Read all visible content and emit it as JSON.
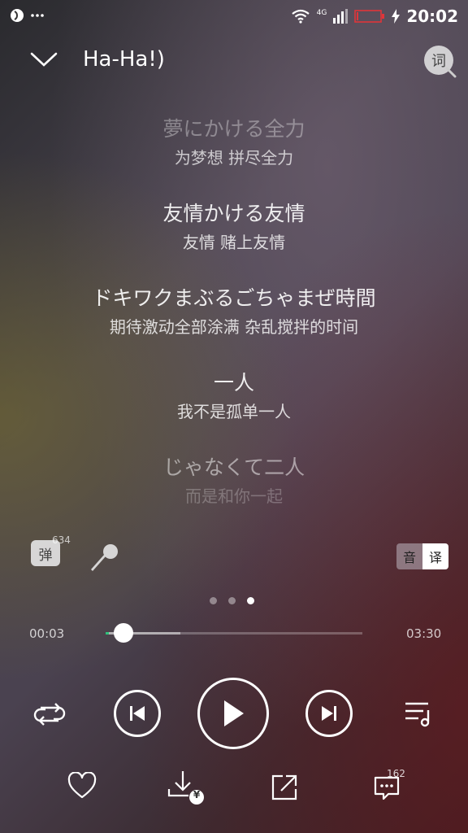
{
  "status_bar": {
    "network": "4G",
    "time": "20:02",
    "icons": [
      "app-icon",
      "more-dots-icon",
      "wifi-icon",
      "signal-icon",
      "battery-low-icon",
      "charging-icon"
    ]
  },
  "header": {
    "title": "Ha-Ha!)",
    "lyrics_button_label": "词"
  },
  "lyrics": [
    {
      "original": "夢にかける全力",
      "translation": "为梦想 拼尽全力"
    },
    {
      "original": "友情かける友情",
      "translation": "友情 赌上友情"
    },
    {
      "original": "ドキワクまぶるごちゃまぜ時間",
      "translation": "期待激动全部涂满 杂乱搅拌的时间"
    },
    {
      "original": "一人",
      "translation": "我不是孤单一人"
    },
    {
      "original": "じゃなくて二人",
      "translation": "而是和你一起"
    }
  ],
  "tools": {
    "danmu_label": "弹",
    "danmu_count": "634",
    "lang_toggle": {
      "left": "音",
      "right": "译"
    }
  },
  "pager": {
    "count": 3,
    "active_index": 2
  },
  "player": {
    "current_time": "00:03",
    "total_time": "03:30",
    "progress_fraction": 0.014,
    "buffered_fraction": 0.29
  },
  "bottom_bar": {
    "comment_count": "162",
    "download_badge": "¥"
  },
  "colors": {
    "accent": "#31c27c",
    "foreground": "#ffffff"
  }
}
